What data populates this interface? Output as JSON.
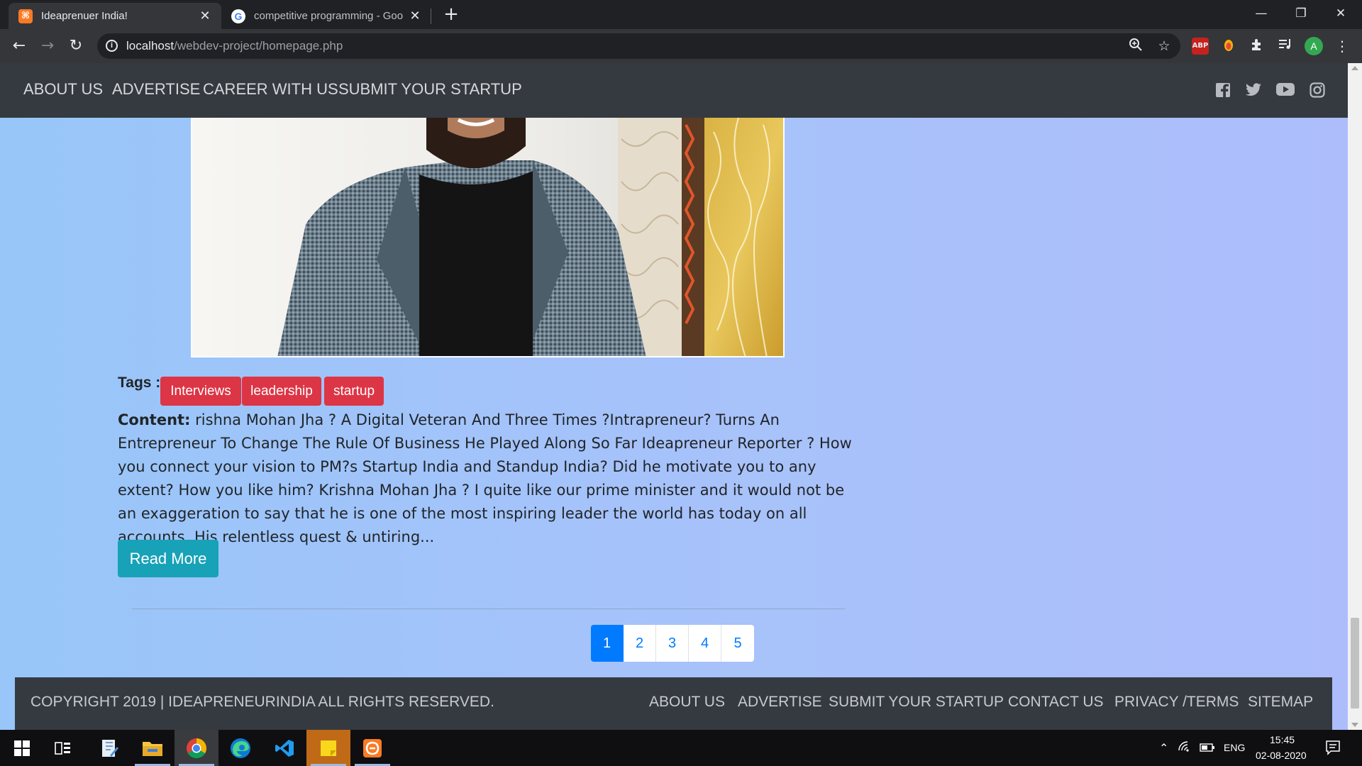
{
  "browser": {
    "tabs": [
      {
        "title": "Ideaprenuer India!",
        "active": true
      },
      {
        "title": "competitive programming - Goo",
        "active": false
      }
    ],
    "url_host": "localhost",
    "url_path": "/webdev-project/homepage.php",
    "profile_initial": "A"
  },
  "nav": {
    "links": [
      "ABOUT US",
      "ADVERTISE",
      "CAREER WITH US",
      "SUBMIT YOUR STARTUP"
    ],
    "social_icons": [
      "facebook-icon",
      "twitter-icon",
      "youtube-icon",
      "instagram-icon"
    ]
  },
  "post": {
    "tags_label": "Tags :",
    "tags": [
      "Interviews",
      "leadership",
      "startup"
    ],
    "content_label": "Content:",
    "content_text": "rishna Mohan Jha ? A Digital Veteran And Three Times ?Intrapreneur? Turns An Entrepreneur To Change The Rule Of Business He Played Along So Far Ideapreneur Reporter ? How you connect your vision to PM?s Startup India and Standup India? Did he motivate you to any extent? How you like him? Krishna Mohan Jha ? I quite like our prime minister and it would not be an exaggeration to say that he is one of the most inspiring leader the world has today on all accounts. His relentless quest & untiring...",
    "read_more": "Read More"
  },
  "pagination": {
    "pages": [
      "1",
      "2",
      "3",
      "4",
      "5"
    ],
    "active_page": "1"
  },
  "footer": {
    "copyright": "COPYRIGHT 2019 | IDEAPRENEURINDIA ALL RIGHTS RESERVED.",
    "links": [
      "ABOUT US",
      "ADVERTISE",
      "SUBMIT YOUR STARTUP",
      "CONTACT US",
      "PRIVACY /TERMS",
      "SITEMAP"
    ]
  },
  "taskbar": {
    "language": "ENG",
    "time": "15:45",
    "date": "02-08-2020"
  },
  "colors": {
    "tag_bg": "#dc3545",
    "read_more_bg": "#17a2b8",
    "page_active_bg": "#007bff",
    "nav_bg": "#343a40"
  }
}
